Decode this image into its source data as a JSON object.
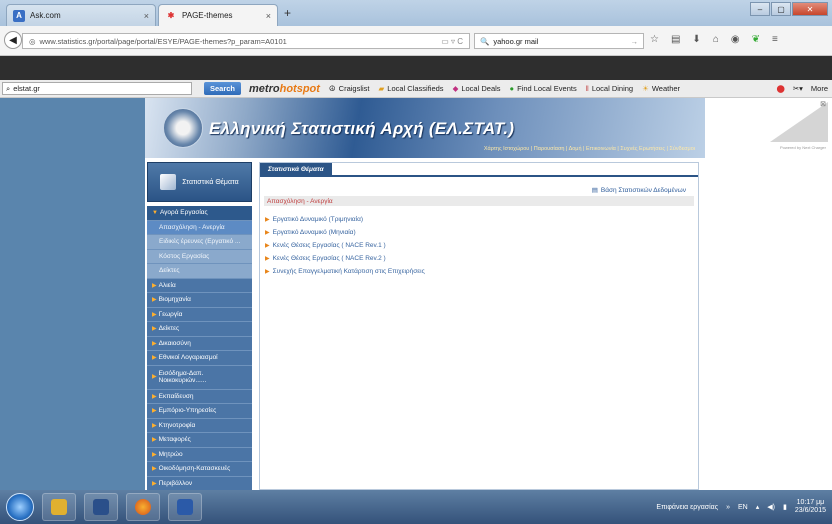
{
  "browser": {
    "tabs": [
      {
        "label": "Ask.com",
        "active": false
      },
      {
        "label": "PAGE-themes",
        "active": true
      }
    ],
    "url": "www.statistics.gr/portal/page/portal/ESYE/PAGE-themes?p_param=A0101",
    "search_value": "yahoo.gr mail",
    "toolbar": {
      "search_value": "elstat.gr",
      "search_button": "Search",
      "logo_metro": "metro",
      "logo_hotspot": "hotspot",
      "links": [
        "Craigslist",
        "Local Classifieds",
        "Local Deals",
        "Find Local Events",
        "Local Dining",
        "Weather"
      ],
      "more": "More"
    }
  },
  "site": {
    "title": "Ελληνική Στατιστική Αρχή (ΕΛ.ΣΤΑΤ.)",
    "header_links": "Χάρτης Ιστοχώρου | Παρουσίαση | Δομή | Επικοινωνία | Συχνές Ερωτήσεις | Σύνδεσμοι",
    "sidebar_title": "Στατιστικά Θέματα",
    "sidebar": {
      "open_section": "Αγορά Εργασίας",
      "sub_items": [
        {
          "label": "Απασχόληση - Ανεργία",
          "selected": true
        },
        {
          "label": "Ειδικές έρευνες (Εργατικό ...",
          "selected": false
        },
        {
          "label": "Κόστος Εργασίας",
          "selected": false
        },
        {
          "label": "Δείκτες",
          "selected": false
        }
      ],
      "items": [
        "Αλιεία",
        "Βιομηχανία",
        "Γεωργία",
        "Δείκτες",
        "Δικαιοσύνη",
        "Εθνικοί Λογαριασμοί",
        "Εισόδημα-Δαπ. Νοικοκυριών......",
        "Εκπαίδευση",
        "Εμπόριο-Υπηρεσίες",
        "Κτηνοτροφία",
        "Μεταφορές",
        "Μητρώο",
        "Οικοδόμηση-Κατασκευές",
        "Περιβάλλον"
      ]
    },
    "content": {
      "tab_label": "Στατιστικά Θέματα",
      "db_link": "Βάση Στατιστικών Δεδομένων",
      "breadcrumb": "Απασχόληση - Ανεργία",
      "links": [
        "Εργατικό Δυναμικό (Τριμηνιαία)",
        "Εργατικό Δυναμικό (Μηνιαία)",
        "Κενές Θέσεις Εργασίας ( NACE Rev.1 )",
        "Κενές Θέσεις Εργασίας ( NACE Rev.2 )",
        "Συνεχής Επαγγελματική Κατάρτιση στις Επιχειρήσεις"
      ]
    },
    "powered_by": "Powered by Next Charger"
  },
  "taskbar": {
    "toolbar_label": "Επιφάνεια εργασίας",
    "language": "EN",
    "time": "10:17 μμ",
    "date": "23/6/2015"
  },
  "colors": {
    "page_bg": "#5a85ad",
    "sidebar": "#4b75a6",
    "accent_orange": "#e8851a",
    "link_blue": "#3865a0"
  }
}
